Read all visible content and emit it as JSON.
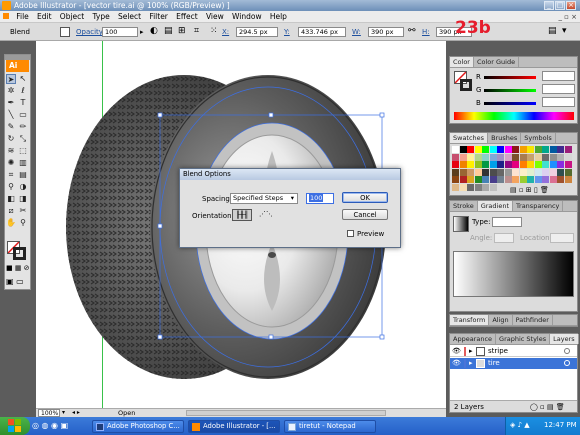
{
  "window": {
    "title": "Adobe Illustrator - [vector tire.ai @ 100% (RGB/Preview) ]",
    "controls": [
      "minimize",
      "maximize",
      "close"
    ]
  },
  "menu": {
    "items": [
      "File",
      "Edit",
      "Object",
      "Type",
      "Select",
      "Filter",
      "Effect",
      "View",
      "Window",
      "Help"
    ]
  },
  "control_bar": {
    "selection_label": "Blend",
    "opacity_label": "Opacity:",
    "opacity_value": "100",
    "x_label": "X:",
    "x_value": "294.5 px",
    "y_label": "Y:",
    "y_value": "433.746 px",
    "w_label": "W:",
    "w_value": "390 px",
    "h_label": "H:",
    "h_value": "390 px"
  },
  "step_mark": "23b",
  "toolbox": {
    "logo": "Ai",
    "icons": [
      "selection-icon",
      "direct-selection-icon",
      "magic-wand-icon",
      "lasso-icon",
      "pen-icon",
      "type-icon",
      "line-icon",
      "rectangle-icon",
      "paintbrush-icon",
      "pencil-icon",
      "rotate-icon",
      "scale-icon",
      "warp-icon",
      "free-transform-icon",
      "symbol-sprayer-icon",
      "column-graph-icon",
      "mesh-icon",
      "gradient-icon",
      "eyedropper-icon",
      "blend-icon",
      "live-paint-icon",
      "live-paint-selection-icon",
      "slice-icon",
      "scissors-icon",
      "hand-icon",
      "zoom-icon"
    ]
  },
  "panels": {
    "color": {
      "tabs": [
        "Color",
        "Color Guide"
      ],
      "channels": [
        "R",
        "G",
        "B"
      ]
    },
    "swatches": {
      "tabs": [
        "Swatches",
        "Brushes",
        "Symbols"
      ],
      "colors": [
        "#ffffff",
        "#000000",
        "#ff0000",
        "#ffff00",
        "#00ff00",
        "#00ffff",
        "#0000ff",
        "#ff00ff",
        "#8a1616",
        "#f3a000",
        "#f7e600",
        "#4da630",
        "#00a78b",
        "#005aa0",
        "#3f2a8f",
        "#9b1d7a",
        "#c74e6e",
        "#f59f8e",
        "#fff19b",
        "#b2d88a",
        "#8bd1c7",
        "#81a8d8",
        "#a391c6",
        "#d6a3c8",
        "#7a4f2a",
        "#a97c50",
        "#c7a26e",
        "#e7cfa0",
        "#6b6b6b",
        "#8f8f8f",
        "#b3b3b3",
        "#d6d6d6",
        "#e60012",
        "#f08300",
        "#fff100",
        "#8fc31f",
        "#009944",
        "#00a0e9",
        "#1d2088",
        "#920783",
        "#e4007f",
        "#ff7f00",
        "#ffd700",
        "#7fff00",
        "#40e0d0",
        "#1e90ff",
        "#8a2be2",
        "#c71585",
        "#5a3d1e",
        "#996633",
        "#cc9966",
        "#ffcc99",
        "#333333",
        "#4d4d4d",
        "#666666",
        "#999999",
        "#fde3d0",
        "#fcf0c8",
        "#e0f0d0",
        "#d0e8f0",
        "#dcd0f0",
        "#f0d0e0",
        "#2f4f4f",
        "#556b2f",
        "#8b4513",
        "#b22222",
        "#daa520",
        "#228b22",
        "#4682b4",
        "#483d8b",
        "#708090",
        "#bc8f8f",
        "#f4a460",
        "#9acd32",
        "#20b2aa",
        "#6495ed",
        "#9370db",
        "#db7093",
        "#a0522d",
        "#cd853f",
        "#deb887",
        "#f5deb3",
        "#696969",
        "#808080",
        "#a9a9a9",
        "#c0c0c0"
      ]
    },
    "gradient": {
      "tabs": [
        "Stroke",
        "Gradient",
        "Transparency"
      ],
      "type_label": "Type:",
      "angle_label": "Angle:",
      "location_label": "Location:"
    },
    "transform": {
      "tabs": [
        "Transform",
        "Align",
        "Pathfinder"
      ]
    },
    "layers": {
      "tabs": [
        "Appearance",
        "Graphic Styles",
        "Layers"
      ],
      "rows": [
        {
          "name": "stripe",
          "color": "#e15b5b",
          "selected": false
        },
        {
          "name": "tire",
          "color": "#4a74d8",
          "selected": true
        }
      ],
      "count_label": "2 Layers"
    }
  },
  "dialog": {
    "title": "Blend Options",
    "spacing_label": "Spacing:",
    "spacing_value": "Specified Steps",
    "steps_value": "100",
    "orientation_label": "Orientation:",
    "ok_label": "OK",
    "cancel_label": "Cancel",
    "preview_label": "Preview",
    "preview_checked": false
  },
  "status_bar": {
    "zoom": "100%",
    "status": "Open"
  },
  "taskbar": {
    "items": [
      {
        "label": "Adobe Photoshop C...",
        "icon": "photoshop-icon"
      },
      {
        "label": "Adobe Illustrator - [...",
        "icon": "illustrator-icon"
      },
      {
        "label": "tiretut - Notepad",
        "icon": "notepad-icon"
      }
    ],
    "clock": "12:47 PM"
  }
}
